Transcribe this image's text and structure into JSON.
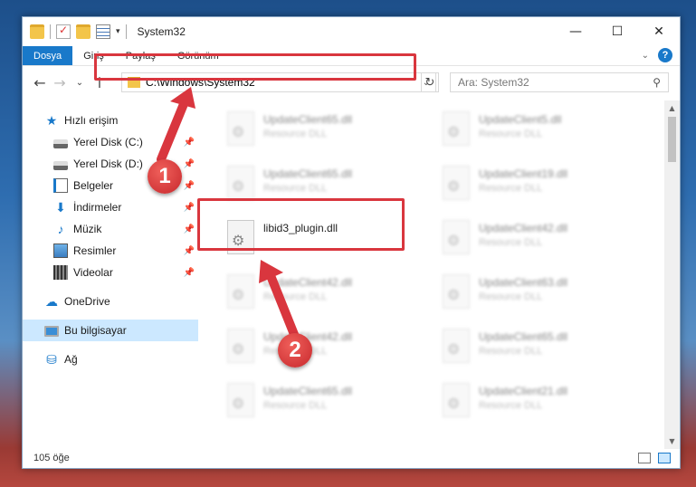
{
  "window": {
    "title": "System32"
  },
  "ribbon": {
    "tabs": [
      "Dosya",
      "Giriş",
      "Paylaş",
      "Görünüm"
    ],
    "help": "?"
  },
  "nav": {
    "address": "C:\\Windows\\System32",
    "search_placeholder": "Ara: System32"
  },
  "sidebar": {
    "items": [
      {
        "label": "Hızlı erişim"
      },
      {
        "label": "Yerel Disk (C:)"
      },
      {
        "label": "Yerel Disk (D:)"
      },
      {
        "label": "Belgeler"
      },
      {
        "label": "İndirmeler"
      },
      {
        "label": "Müzik"
      },
      {
        "label": "Resimler"
      },
      {
        "label": "Videolar"
      },
      {
        "label": "OneDrive"
      },
      {
        "label": "Bu bilgisayar"
      },
      {
        "label": "Ağ"
      }
    ]
  },
  "files": {
    "left": [
      {
        "name": "UpdateClient65.dll",
        "type": "Resource DLL"
      },
      {
        "name": "UpdateClient65.dll",
        "type": "Resource DLL"
      },
      {
        "name": "libid3_plugin.dll",
        "type": ""
      },
      {
        "name": "UpdateClient42.dll",
        "type": "Resource DLL"
      },
      {
        "name": "UpdateClient42.dll",
        "type": "Resource DLL"
      },
      {
        "name": "UpdateClient65.dll",
        "type": "Resource DLL"
      }
    ],
    "right": [
      {
        "name": "UpdateClient5.dll",
        "type": "Resource DLL"
      },
      {
        "name": "UpdateClient19.dll",
        "type": "Resource DLL"
      },
      {
        "name": "UpdateClient42.dll",
        "type": "Resource DLL"
      },
      {
        "name": "UpdateClient63.dll",
        "type": "Resource DLL"
      },
      {
        "name": "UpdateClient65.dll",
        "type": "Resource DLL"
      },
      {
        "name": "UpdateClient21.dll",
        "type": "Resource DLL"
      }
    ]
  },
  "status": {
    "count": "105 öğe"
  },
  "annotations": {
    "step1": "1",
    "step2": "2"
  },
  "colors": {
    "accent": "#1979ca",
    "highlight": "#d9363e"
  }
}
